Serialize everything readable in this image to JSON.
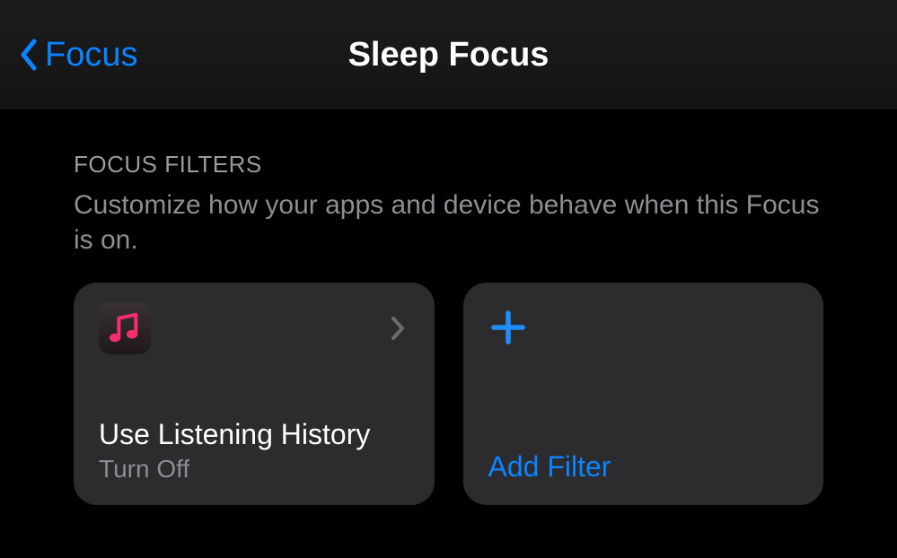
{
  "nav": {
    "back_label": "Focus",
    "title": "Sleep Focus"
  },
  "section": {
    "header": "FOCUS FILTERS",
    "description": "Customize how your apps and device behave when this Focus is on."
  },
  "cards": {
    "filter": {
      "title": "Use Listening History",
      "subtitle": "Turn Off"
    },
    "add": {
      "label": "Add Filter"
    }
  }
}
